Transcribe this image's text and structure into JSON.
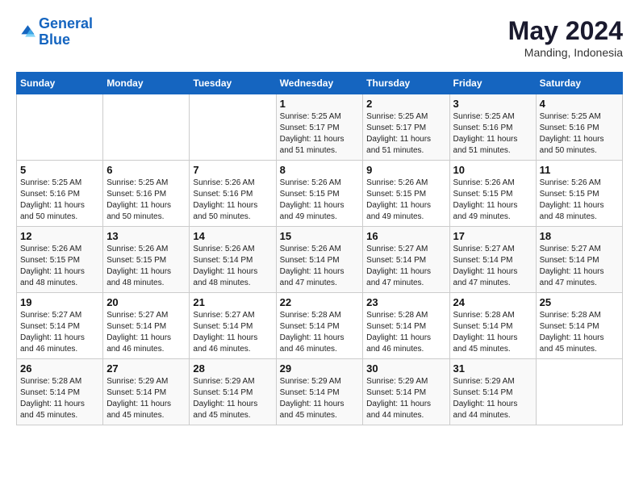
{
  "logo": {
    "line1": "General",
    "line2": "Blue"
  },
  "title": "May 2024",
  "subtitle": "Manding, Indonesia",
  "days_of_week": [
    "Sunday",
    "Monday",
    "Tuesday",
    "Wednesday",
    "Thursday",
    "Friday",
    "Saturday"
  ],
  "weeks": [
    [
      {
        "day": "",
        "info": ""
      },
      {
        "day": "",
        "info": ""
      },
      {
        "day": "",
        "info": ""
      },
      {
        "day": "1",
        "info": "Sunrise: 5:25 AM\nSunset: 5:17 PM\nDaylight: 11 hours\nand 51 minutes."
      },
      {
        "day": "2",
        "info": "Sunrise: 5:25 AM\nSunset: 5:17 PM\nDaylight: 11 hours\nand 51 minutes."
      },
      {
        "day": "3",
        "info": "Sunrise: 5:25 AM\nSunset: 5:16 PM\nDaylight: 11 hours\nand 51 minutes."
      },
      {
        "day": "4",
        "info": "Sunrise: 5:25 AM\nSunset: 5:16 PM\nDaylight: 11 hours\nand 50 minutes."
      }
    ],
    [
      {
        "day": "5",
        "info": "Sunrise: 5:25 AM\nSunset: 5:16 PM\nDaylight: 11 hours\nand 50 minutes."
      },
      {
        "day": "6",
        "info": "Sunrise: 5:25 AM\nSunset: 5:16 PM\nDaylight: 11 hours\nand 50 minutes."
      },
      {
        "day": "7",
        "info": "Sunrise: 5:26 AM\nSunset: 5:16 PM\nDaylight: 11 hours\nand 50 minutes."
      },
      {
        "day": "8",
        "info": "Sunrise: 5:26 AM\nSunset: 5:15 PM\nDaylight: 11 hours\nand 49 minutes."
      },
      {
        "day": "9",
        "info": "Sunrise: 5:26 AM\nSunset: 5:15 PM\nDaylight: 11 hours\nand 49 minutes."
      },
      {
        "day": "10",
        "info": "Sunrise: 5:26 AM\nSunset: 5:15 PM\nDaylight: 11 hours\nand 49 minutes."
      },
      {
        "day": "11",
        "info": "Sunrise: 5:26 AM\nSunset: 5:15 PM\nDaylight: 11 hours\nand 48 minutes."
      }
    ],
    [
      {
        "day": "12",
        "info": "Sunrise: 5:26 AM\nSunset: 5:15 PM\nDaylight: 11 hours\nand 48 minutes."
      },
      {
        "day": "13",
        "info": "Sunrise: 5:26 AM\nSunset: 5:15 PM\nDaylight: 11 hours\nand 48 minutes."
      },
      {
        "day": "14",
        "info": "Sunrise: 5:26 AM\nSunset: 5:14 PM\nDaylight: 11 hours\nand 48 minutes."
      },
      {
        "day": "15",
        "info": "Sunrise: 5:26 AM\nSunset: 5:14 PM\nDaylight: 11 hours\nand 47 minutes."
      },
      {
        "day": "16",
        "info": "Sunrise: 5:27 AM\nSunset: 5:14 PM\nDaylight: 11 hours\nand 47 minutes."
      },
      {
        "day": "17",
        "info": "Sunrise: 5:27 AM\nSunset: 5:14 PM\nDaylight: 11 hours\nand 47 minutes."
      },
      {
        "day": "18",
        "info": "Sunrise: 5:27 AM\nSunset: 5:14 PM\nDaylight: 11 hours\nand 47 minutes."
      }
    ],
    [
      {
        "day": "19",
        "info": "Sunrise: 5:27 AM\nSunset: 5:14 PM\nDaylight: 11 hours\nand 46 minutes."
      },
      {
        "day": "20",
        "info": "Sunrise: 5:27 AM\nSunset: 5:14 PM\nDaylight: 11 hours\nand 46 minutes."
      },
      {
        "day": "21",
        "info": "Sunrise: 5:27 AM\nSunset: 5:14 PM\nDaylight: 11 hours\nand 46 minutes."
      },
      {
        "day": "22",
        "info": "Sunrise: 5:28 AM\nSunset: 5:14 PM\nDaylight: 11 hours\nand 46 minutes."
      },
      {
        "day": "23",
        "info": "Sunrise: 5:28 AM\nSunset: 5:14 PM\nDaylight: 11 hours\nand 46 minutes."
      },
      {
        "day": "24",
        "info": "Sunrise: 5:28 AM\nSunset: 5:14 PM\nDaylight: 11 hours\nand 45 minutes."
      },
      {
        "day": "25",
        "info": "Sunrise: 5:28 AM\nSunset: 5:14 PM\nDaylight: 11 hours\nand 45 minutes."
      }
    ],
    [
      {
        "day": "26",
        "info": "Sunrise: 5:28 AM\nSunset: 5:14 PM\nDaylight: 11 hours\nand 45 minutes."
      },
      {
        "day": "27",
        "info": "Sunrise: 5:29 AM\nSunset: 5:14 PM\nDaylight: 11 hours\nand 45 minutes."
      },
      {
        "day": "28",
        "info": "Sunrise: 5:29 AM\nSunset: 5:14 PM\nDaylight: 11 hours\nand 45 minutes."
      },
      {
        "day": "29",
        "info": "Sunrise: 5:29 AM\nSunset: 5:14 PM\nDaylight: 11 hours\nand 45 minutes."
      },
      {
        "day": "30",
        "info": "Sunrise: 5:29 AM\nSunset: 5:14 PM\nDaylight: 11 hours\nand 44 minutes."
      },
      {
        "day": "31",
        "info": "Sunrise: 5:29 AM\nSunset: 5:14 PM\nDaylight: 11 hours\nand 44 minutes."
      },
      {
        "day": "",
        "info": ""
      }
    ]
  ]
}
